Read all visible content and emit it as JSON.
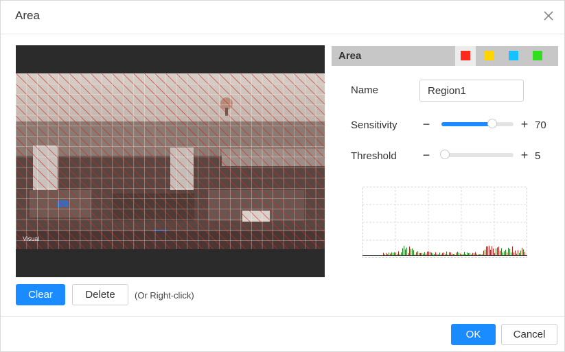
{
  "dialog": {
    "title": "Area"
  },
  "video": {
    "overlay_text": "Visual"
  },
  "buttons": {
    "clear": "Clear",
    "delete": "Delete",
    "hint": "(Or Right-click)",
    "ok": "OK",
    "cancel": "Cancel"
  },
  "area": {
    "label": "Area",
    "colors": [
      {
        "name": "red",
        "hex": "#ff2a1a",
        "selected": true
      },
      {
        "name": "yellow",
        "hex": "#ffd500",
        "selected": false
      },
      {
        "name": "cyan",
        "hex": "#15c1ff",
        "selected": false
      },
      {
        "name": "green",
        "hex": "#33dd22",
        "selected": false
      }
    ]
  },
  "form": {
    "name_label": "Name",
    "name_value": "Region1",
    "sensitivity_label": "Sensitivity",
    "sensitivity_value": "70",
    "sensitivity_level": 0.7,
    "threshold_label": "Threshold",
    "threshold_value": "5",
    "threshold_level": 0.05,
    "minus": "−",
    "plus": "+"
  },
  "icons": {
    "close": "close-icon"
  }
}
